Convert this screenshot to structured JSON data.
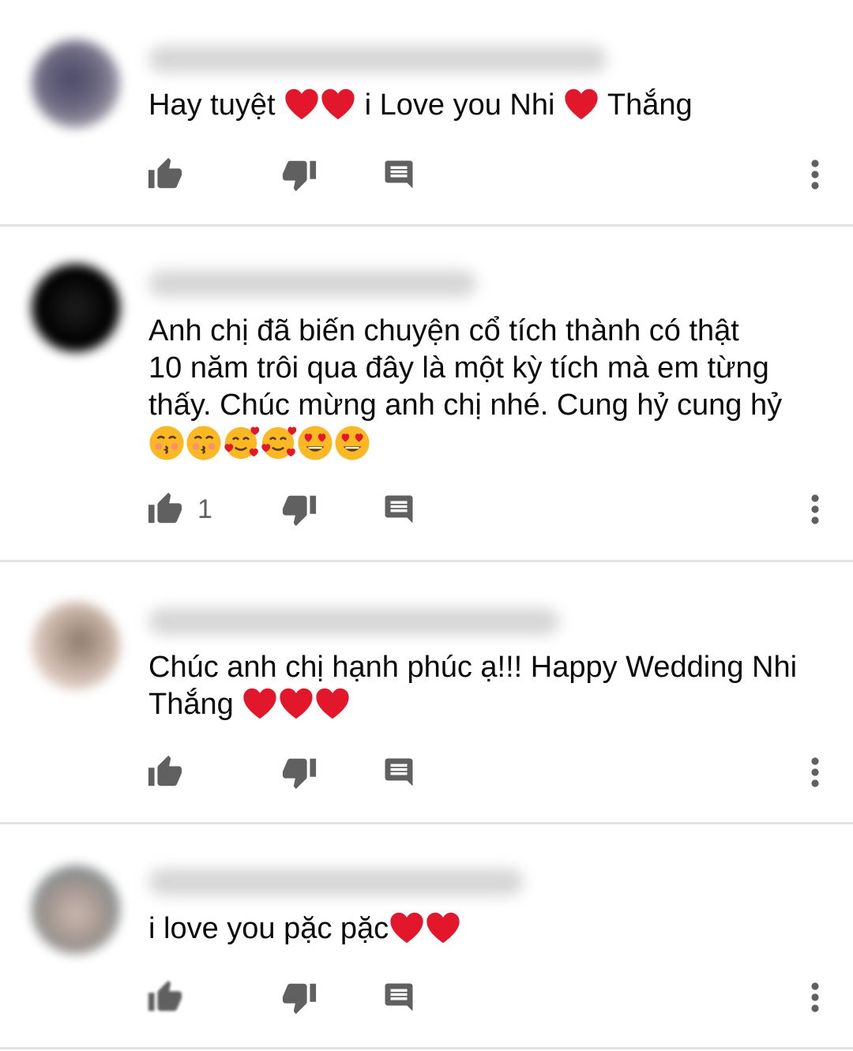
{
  "comments": [
    {
      "author_meta": "",
      "segments": [
        "Hay tuyệt ",
        "i Love you Nhi ",
        "Thắng"
      ],
      "like_count": "",
      "avatar_colors": [
        "#4b4a6a",
        "#c9c5c9"
      ]
    },
    {
      "author_meta": "",
      "lines": [
        "Anh chị đã biến chuyện cổ tích thành có thật",
        "10 năm trôi qua đây là một kỳ tích mà em từng",
        "thấy. Chúc mừng anh chị nhé. Cung hỷ cung hỷ"
      ],
      "emojis": [
        "kissing-face",
        "kissing-face",
        "smiling-face-with-hearts",
        "smiling-face-with-hearts",
        "heart-eyes-face",
        "heart-eyes-face"
      ],
      "like_count": "1",
      "avatar_colors": [
        "#000000",
        "#1e1e1e"
      ]
    },
    {
      "author_meta": "",
      "lines": [
        "Chúc anh chị hạnh phúc ạ!!! Happy Wedding Nhi",
        "Thắng"
      ],
      "like_count": "",
      "avatar_colors": [
        "#e9d7cf",
        "#8d7a6c"
      ]
    },
    {
      "author_meta": "",
      "segments": [
        "i love you pặc pặc"
      ],
      "like_count": "",
      "avatar_colors": [
        "#c9b8b0",
        "#7c8a8e"
      ]
    }
  ],
  "colors": {
    "heart": "#e3172c",
    "icon": "#606060",
    "text": "#0b0b0b",
    "divider": "#e3e3e3"
  }
}
